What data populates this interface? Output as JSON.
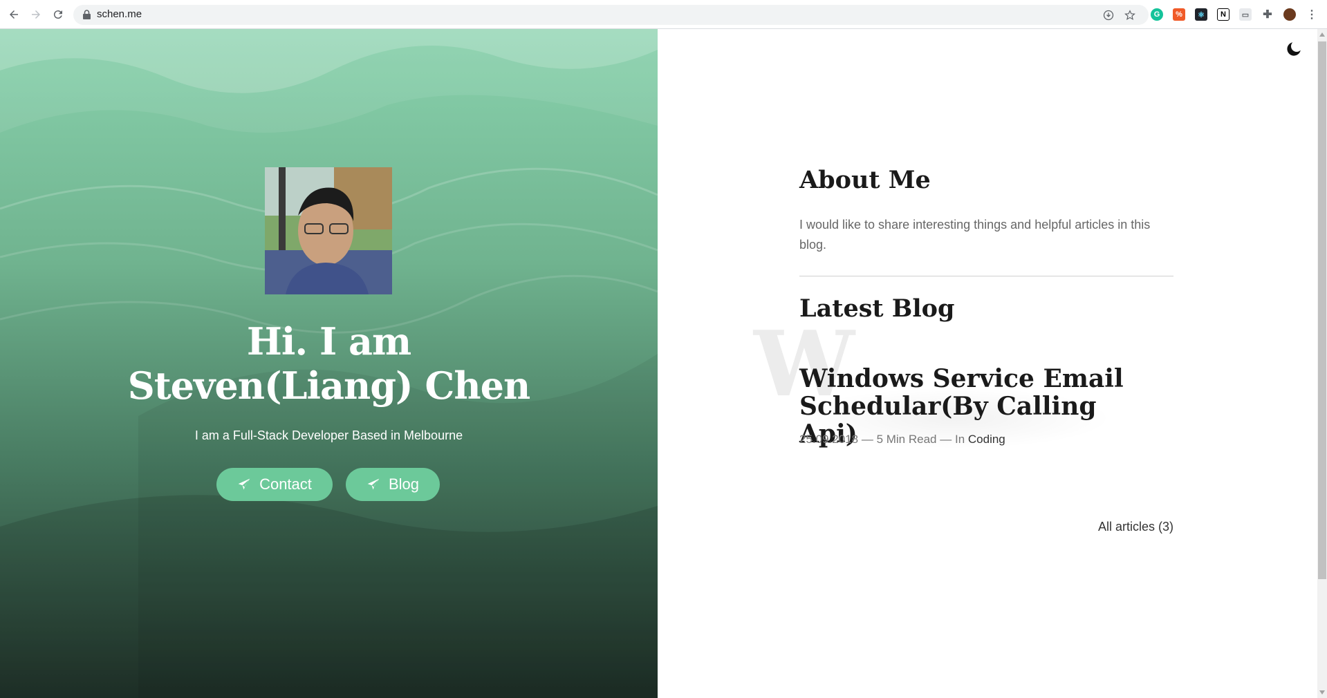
{
  "browser": {
    "url": "schen.me",
    "icons": [
      "back-arrow-icon",
      "forward-arrow-icon",
      "reload-icon",
      "lock-icon",
      "install-icon",
      "star-icon",
      "grammarly-icon",
      "ext-orange-icon",
      "react-devtools-icon",
      "notion-icon",
      "cast-icon",
      "puzzle-icon",
      "profile-avatar-icon",
      "kebab-menu-icon"
    ]
  },
  "hero": {
    "title_line1": "Hi. I am",
    "title_line2": "Steven(Liang) Chen",
    "subtitle": "I am a Full-Stack Developer Based in Melbourne",
    "contact_label": "Contact",
    "blog_label": "Blog",
    "accent": "#6cc99a"
  },
  "about": {
    "heading": "About Me",
    "text": "I would like to share interesting things and helpful articles in this blog."
  },
  "latest": {
    "heading": "Latest Blog",
    "bg_letter": "W",
    "post": {
      "title": "Windows Service Email Schedular(By Calling Api)",
      "date": "25.09.2018",
      "read_time": "5 Min Read",
      "in_label": "In",
      "category": "Coding",
      "separator": "—"
    },
    "all_articles": "All articles (3)"
  }
}
